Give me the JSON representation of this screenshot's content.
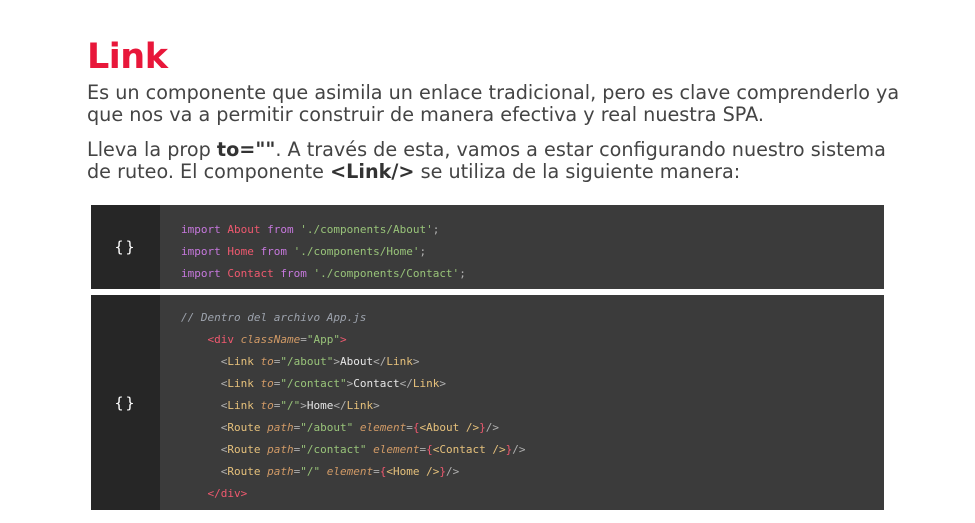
{
  "title": "Link",
  "para1": "Es un componente que asimila un enlace tradicional, pero es clave comprenderlo ya que nos va a permitir construir de manera efectiva y real nuestra SPA.",
  "para2": {
    "a": "Lleva la prop ",
    "b": "to=\"\"",
    "c": ". A través de esta, vamos a estar configurando nuestro sistema de ruteo. El componente ",
    "d": "<Link/>",
    "e": " se utiliza de la siguiente manera:"
  },
  "gutter_icon": "{}",
  "block1": {
    "lines": [
      {
        "kw1": "import",
        "name": "About",
        "kw2": "from",
        "path": "'./components/About'",
        "end": ";"
      },
      {
        "kw1": "import",
        "name": "Home",
        "kw2": "from",
        "path": "'./components/Home'",
        "end": ";"
      },
      {
        "kw1": "import",
        "name": "Contact",
        "kw2": "from",
        "path": "'./components/Contact'",
        "end": ";"
      }
    ]
  },
  "block2": {
    "comment": "// Dentro del archivo App.js",
    "div_open": {
      "lt": "<",
      "tag": "div",
      "attr": "className",
      "eq": "=",
      "val": "\"App\"",
      "gt": ">"
    },
    "links": [
      {
        "lt": "<",
        "comp": "Link",
        "attr": "to",
        "eq": "=",
        "val": "\"/about\"",
        "gt": ">",
        "text": "About",
        "close_lt": "</",
        "close": "Link",
        "close_gt": ">"
      },
      {
        "lt": "<",
        "comp": "Link",
        "attr": "to",
        "eq": "=",
        "val": "\"/contact\"",
        "gt": ">",
        "text": "Contact",
        "close_lt": "</",
        "close": "Link",
        "close_gt": ">"
      },
      {
        "lt": "<",
        "comp": "Link",
        "attr": "to",
        "eq": "=",
        "val": "\"/\"",
        "gt": ">",
        "text": "Home",
        "close_lt": "</",
        "close": "Link",
        "close_gt": ">"
      }
    ],
    "routes": [
      {
        "lt": "<",
        "comp": "Route",
        "a1": "path",
        "eq1": "=",
        "v1": "\"/about\"",
        "a2": "element",
        "eq2": "=",
        "ob": "{",
        "inner": "<About />",
        "cb": "}",
        "end": "/>"
      },
      {
        "lt": "<",
        "comp": "Route",
        "a1": "path",
        "eq1": "=",
        "v1": "\"/contact\"",
        "a2": "element",
        "eq2": "=",
        "ob": "{",
        "inner": "<Contact />",
        "cb": "}",
        "end": "/>"
      },
      {
        "lt": "<",
        "comp": "Route",
        "a1": "path",
        "eq1": "=",
        "v1": "\"/\"",
        "a2": "element",
        "eq2": "=",
        "ob": "{",
        "inner": "<Home />",
        "cb": "}",
        "end": "/>"
      }
    ],
    "div_close": "</div>"
  }
}
